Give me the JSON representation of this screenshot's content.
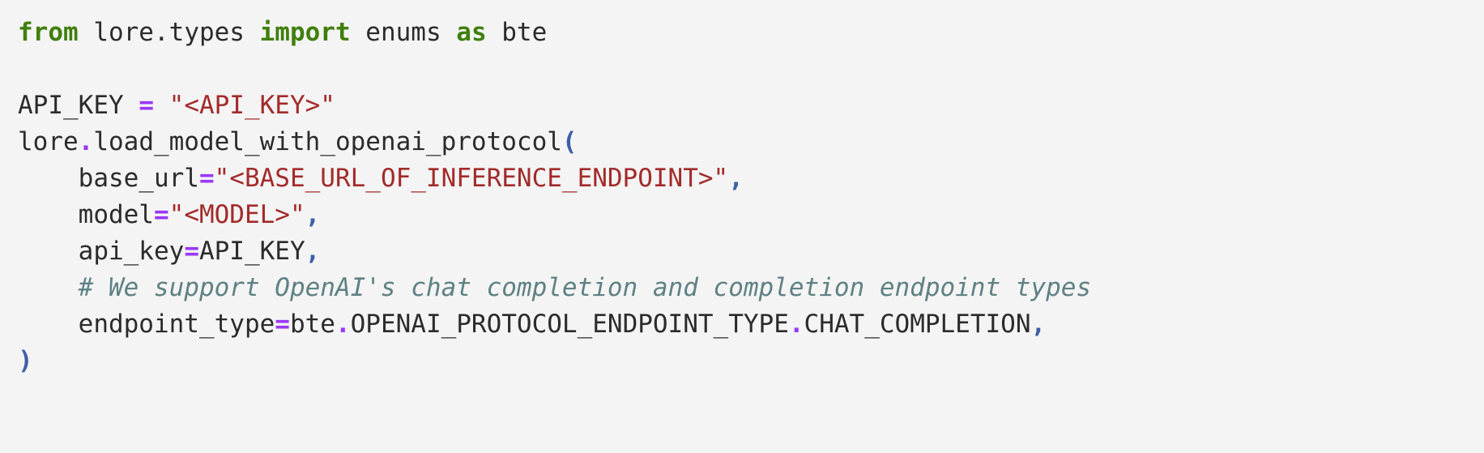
{
  "editor": {
    "language": "python",
    "background_color": "#f4f4f4",
    "theme_colors": {
      "keyword": "#3f7f0d",
      "operator": "#9a38f5",
      "string": "#a32b2b",
      "punctuation": "#3d5fa8",
      "comment": "#5f8183",
      "identifier": "#2b2b2b"
    }
  },
  "code": {
    "lines": [
      {
        "id": "line-1",
        "tokens": [
          {
            "text": "from",
            "type": "keyword"
          },
          {
            "text": " lore",
            "type": "identifier"
          },
          {
            "text": ".",
            "type": "identifier"
          },
          {
            "text": "types ",
            "type": "identifier"
          },
          {
            "text": "import",
            "type": "keyword"
          },
          {
            "text": " enums ",
            "type": "identifier"
          },
          {
            "text": "as",
            "type": "keyword"
          },
          {
            "text": " bte",
            "type": "identifier"
          }
        ]
      },
      {
        "id": "line-2",
        "tokens": []
      },
      {
        "id": "line-3",
        "tokens": [
          {
            "text": "API_KEY ",
            "type": "identifier"
          },
          {
            "text": "=",
            "type": "operator"
          },
          {
            "text": " ",
            "type": "identifier"
          },
          {
            "text": "\"<API_KEY>\"",
            "type": "string"
          }
        ]
      },
      {
        "id": "line-4",
        "tokens": [
          {
            "text": "lore",
            "type": "identifier"
          },
          {
            "text": ".",
            "type": "operator"
          },
          {
            "text": "load_model_with_openai_protocol",
            "type": "identifier"
          },
          {
            "text": "(",
            "type": "punctuation"
          }
        ]
      },
      {
        "id": "line-5",
        "tokens": [
          {
            "text": "    base_url",
            "type": "identifier"
          },
          {
            "text": "=",
            "type": "operator"
          },
          {
            "text": "\"<BASE_URL_OF_INFERENCE_ENDPOINT>\"",
            "type": "string"
          },
          {
            "text": ",",
            "type": "punctuation"
          }
        ]
      },
      {
        "id": "line-6",
        "tokens": [
          {
            "text": "    model",
            "type": "identifier"
          },
          {
            "text": "=",
            "type": "operator"
          },
          {
            "text": "\"<MODEL>\"",
            "type": "string"
          },
          {
            "text": ",",
            "type": "punctuation"
          }
        ]
      },
      {
        "id": "line-7",
        "tokens": [
          {
            "text": "    api_key",
            "type": "identifier"
          },
          {
            "text": "=",
            "type": "operator"
          },
          {
            "text": "API_KEY",
            "type": "identifier"
          },
          {
            "text": ",",
            "type": "punctuation"
          }
        ]
      },
      {
        "id": "line-8",
        "tokens": [
          {
            "text": "    ",
            "type": "identifier"
          },
          {
            "text": "# We support OpenAI's chat completion and completion endpoint types",
            "type": "comment"
          }
        ]
      },
      {
        "id": "line-9",
        "tokens": [
          {
            "text": "    endpoint_type",
            "type": "identifier"
          },
          {
            "text": "=",
            "type": "operator"
          },
          {
            "text": "bte",
            "type": "identifier"
          },
          {
            "text": ".",
            "type": "operator"
          },
          {
            "text": "OPENAI_PROTOCOL_ENDPOINT_TYPE",
            "type": "identifier"
          },
          {
            "text": ".",
            "type": "operator"
          },
          {
            "text": "CHAT_COMPLETION",
            "type": "identifier"
          },
          {
            "text": ",",
            "type": "punctuation"
          }
        ]
      },
      {
        "id": "line-10",
        "tokens": [
          {
            "text": ")",
            "type": "punctuation"
          }
        ]
      }
    ]
  }
}
